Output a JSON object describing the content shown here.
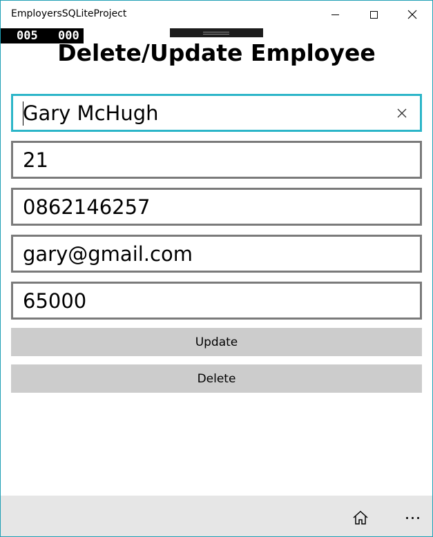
{
  "window": {
    "title": "EmployersSQLiteProject",
    "accent_color": "#2bb5c8"
  },
  "frame_counter": {
    "value_a": "005",
    "value_b": "000"
  },
  "page": {
    "title": "Delete/Update Employee"
  },
  "form": {
    "name_value": "Gary McHugh",
    "age_value": "21",
    "phone_value": "0862146257",
    "email_value": "gary@gmail.com",
    "salary_value": "65000"
  },
  "actions": {
    "update_label": "Update",
    "delete_label": "Delete"
  },
  "command_bar": {
    "home_icon": "home-icon",
    "more_icon": "more-icon"
  }
}
